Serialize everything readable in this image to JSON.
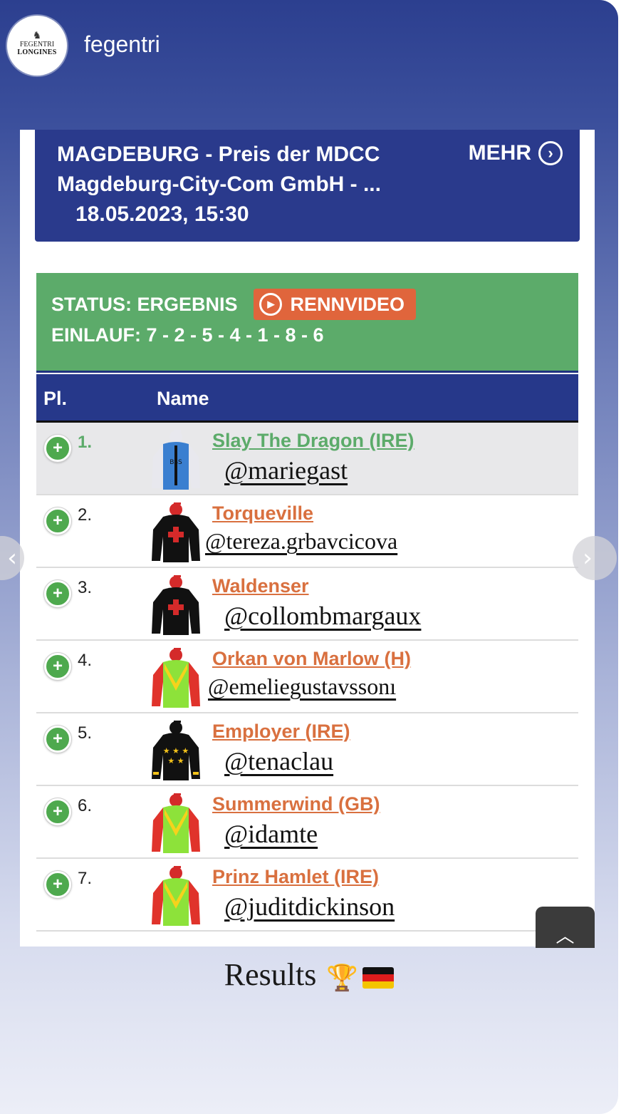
{
  "account": {
    "username": "fegentri",
    "avatar_line1": "FEGENTRI",
    "avatar_line2": "LONGINES"
  },
  "race": {
    "title": "MAGDEBURG - Preis der MDCC Magdeburg-City-Com GmbH - ...",
    "datetime": "18.05.2023, 15:30",
    "more_label": "MEHR"
  },
  "status": {
    "label": "STATUS: ERGEBNIS",
    "video_label": "RENNVIDEO",
    "einlauf": "EINLAUF: 7 - 2 - 5 - 4 - 1 - 8 - 6"
  },
  "table": {
    "col_place": "Pl.",
    "col_name": "Name",
    "rows": [
      {
        "place": "1.",
        "horse": "Slay The Dragon (IRE)",
        "jockey": "@mariegast",
        "silk": "blue"
      },
      {
        "place": "2.",
        "horse": "Torqueville",
        "jockey": "@tereza.grbavcicova",
        "silk": "black-cross"
      },
      {
        "place": "3.",
        "horse": "Waldenser",
        "jockey": "@collombmargaux",
        "silk": "black-cross"
      },
      {
        "place": "4.",
        "horse": "Orkan von Marlow (H)",
        "jockey": "@emeliegustavssonı",
        "silk": "green-chevron"
      },
      {
        "place": "5.",
        "horse": "Employer (IRE)",
        "jockey": "@tenaclau",
        "silk": "black-stars"
      },
      {
        "place": "6.",
        "horse": "Summerwind (GB)",
        "jockey": "@idamte",
        "silk": "green-chevron"
      },
      {
        "place": "7.",
        "horse": "Prinz Hamlet (IRE)",
        "jockey": "@juditdickinson",
        "silk": "green-chevron"
      }
    ]
  },
  "caption": {
    "text": "Results",
    "emoji": "🏆"
  },
  "colors": {
    "header_blue": "#2a3a8c",
    "status_green": "#5cab6a",
    "video_orange": "#e0653c",
    "link_orange": "#d9703f"
  }
}
